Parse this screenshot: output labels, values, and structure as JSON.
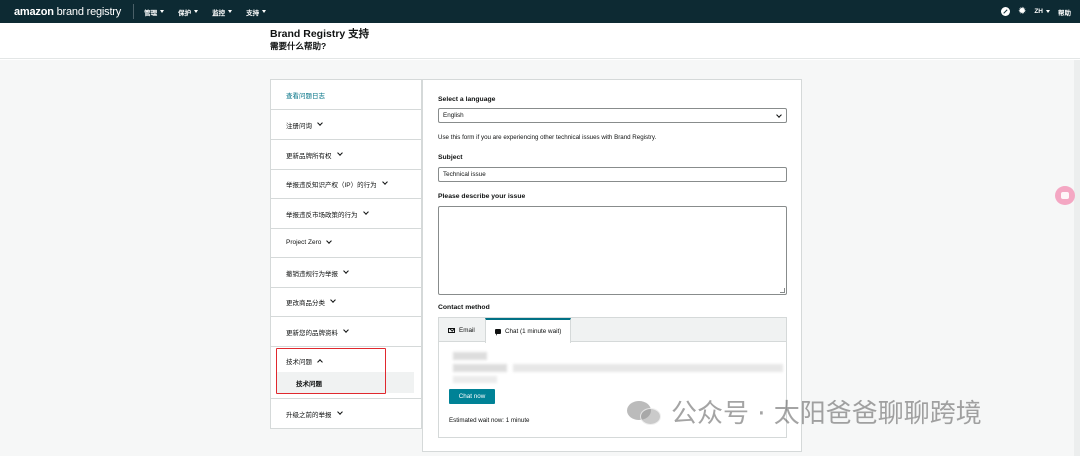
{
  "nav": {
    "logo_amazon": "amazon",
    "logo_brand": " brand registry",
    "items": [
      {
        "label": "管理"
      },
      {
        "label": "保护"
      },
      {
        "label": "监控"
      },
      {
        "label": "支持"
      }
    ],
    "lang": "ZH",
    "help": "帮助",
    "icons": [
      "compass-icon",
      "gear-icon"
    ]
  },
  "header": {
    "title": "Brand Registry 支持",
    "subtitle": "需要什么帮助?"
  },
  "sidebar": {
    "items": [
      {
        "label": "查看问题日志",
        "link": true
      },
      {
        "label": "注册问询"
      },
      {
        "label": "更新品牌所有权"
      },
      {
        "label": "举报违反知识产权（IP）的行为"
      },
      {
        "label": "举报违反市场政策的行为"
      },
      {
        "label": "Project Zero"
      },
      {
        "label": "撤销违规行为举报"
      },
      {
        "label": "更改商品分类"
      },
      {
        "label": "更新您的品牌资料"
      },
      {
        "label": "技术问题",
        "expanded": true
      },
      {
        "label": "升级之前的举报"
      }
    ],
    "sub_item": "技术问题"
  },
  "form": {
    "language_label": "Select a language",
    "language_value": "English",
    "note": "Use this form if you are experiencing other technical issues with Brand Registry.",
    "subject_label": "Subject",
    "subject_value": "Technical issue",
    "describe_label": "Please describe your issue",
    "describe_value": "",
    "contact_label": "Contact method",
    "tabs": [
      {
        "label": "Email",
        "icon": "mail-icon"
      },
      {
        "label": "Chat (1 minute wait)",
        "icon": "chat-icon",
        "active": true
      }
    ],
    "chat_button": "Chat now",
    "wait_text": "Estimated wait now: 1 minute"
  },
  "watermark": {
    "text": "公众号 · 太阳爸爸聊聊跨境"
  },
  "colors": {
    "nav_bg": "#0d2a33",
    "accent": "#008296",
    "link": "#007185",
    "highlight": "#e0282e"
  }
}
